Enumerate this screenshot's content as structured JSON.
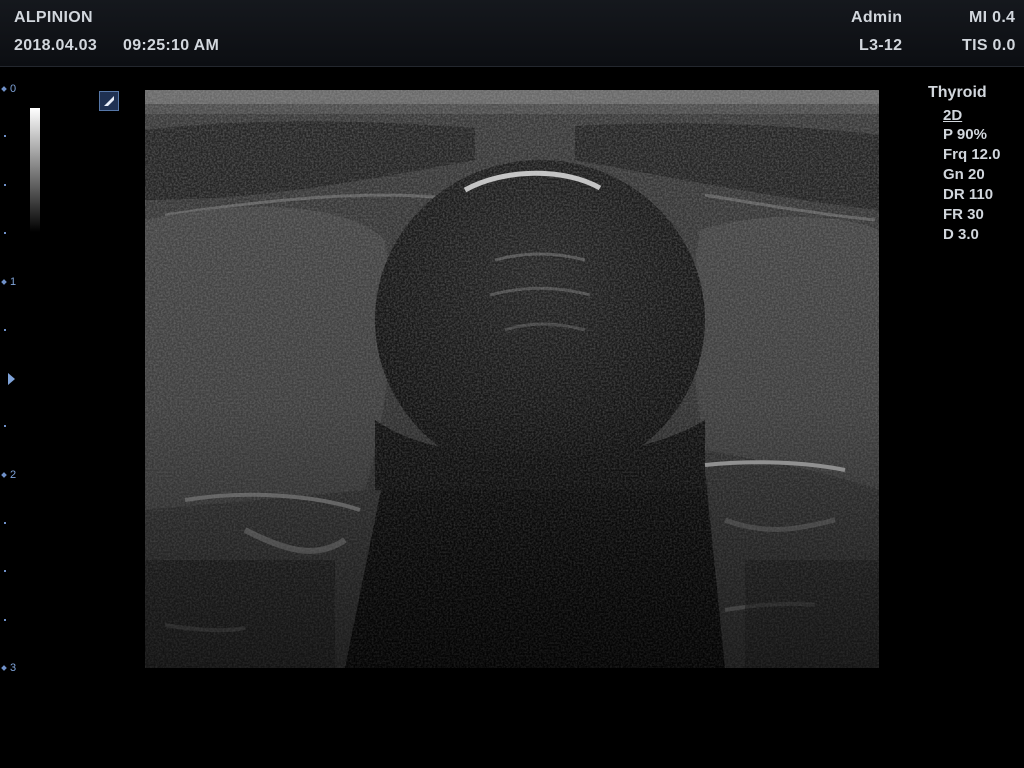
{
  "header": {
    "brand": "ALPINION",
    "date": "2018.04.03",
    "time": "09:25:10 AM",
    "user": "Admin",
    "mi": "MI 0.4",
    "probe": "L3-12",
    "tis": "TIS 0.0"
  },
  "depth_scale": {
    "labels": [
      "0",
      "1",
      "2",
      "3"
    ],
    "unit_labels_color": "#7fa3d9"
  },
  "imaging_params": {
    "preset": "Thyroid",
    "mode": "2D",
    "power": "P 90%",
    "frequency": "Frq 12.0",
    "gain": "Gn 20",
    "dynamic_range": "DR 110",
    "frame_rate": "FR 30",
    "depth": "D 3.0"
  },
  "icons": {
    "orientation_marker": "orientation-marker-icon",
    "focus_marker": "focus-arrow-icon"
  },
  "colors": {
    "background": "#000000",
    "header_text": "#d2d7dd",
    "scale_blue": "#7fa3d9"
  }
}
